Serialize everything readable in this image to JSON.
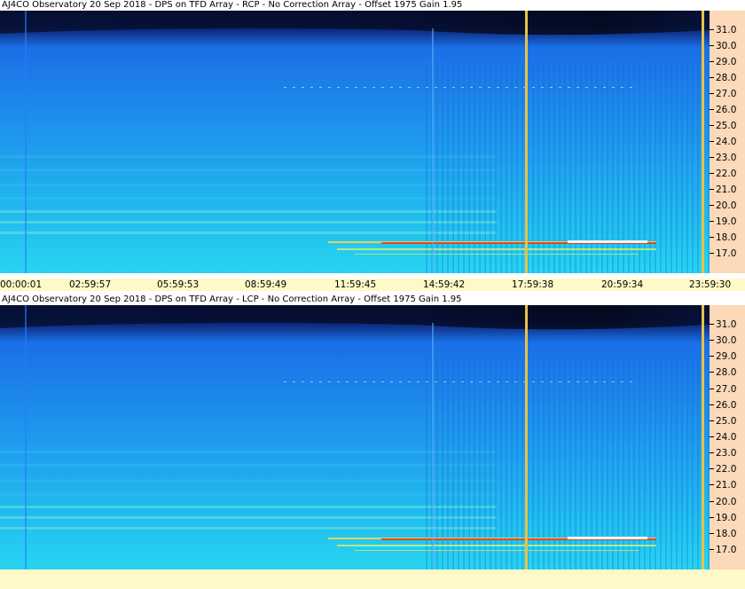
{
  "colors": {
    "cold": "#050d2e",
    "mid": "#1a6fe6",
    "warm": "#22c3ef",
    "hot": "#7ff0d8",
    "marker": "#e6c34a",
    "axis_bg": "#fcd9b8",
    "time_bg": "#fff8c8"
  },
  "panels": [
    {
      "title": "AJ4CO Observatory 20 Sep 2018 - DPS on TFD Array  - RCP  -  No Correction Array  -  Offset 1975  Gain 1.95",
      "y_ticks": [
        "31.0",
        "30.0",
        "29.0",
        "28.0",
        "27.0",
        "26.0",
        "25.0",
        "24.0",
        "23.0",
        "22.0",
        "21.0",
        "20.0",
        "19.0",
        "18.0",
        "17.0"
      ]
    },
    {
      "title": "AJ4CO Observatory 20 Sep 2018 - DPS on TFD Array  - LCP  -  No Correction Array  -  Offset 1975  Gain 1.95",
      "y_ticks": [
        "31.0",
        "30.0",
        "29.0",
        "28.0",
        "27.0",
        "26.0",
        "25.0",
        "24.0",
        "23.0",
        "22.0",
        "21.0",
        "20.0",
        "19.0",
        "18.0",
        "17.0"
      ]
    }
  ],
  "x_ticks": [
    "00:00:01",
    "02:59:57",
    "05:59:53",
    "08:59:49",
    "11:59:45",
    "14:59:42",
    "17:59:38",
    "20:59:34",
    "23:59:30"
  ],
  "chart_data": [
    {
      "type": "heatmap",
      "title": "AJ4CO Observatory 20 Sep 2018 - DPS on TFD Array  - RCP  -  No Correction Array  -  Offset 1975  Gain 1.95",
      "ylabel": "",
      "y_ticks": [
        31.0,
        30.0,
        29.0,
        28.0,
        27.0,
        26.0,
        25.0,
        24.0,
        23.0,
        22.0,
        21.0,
        20.0,
        19.0,
        18.0,
        17.0
      ],
      "ylim": [
        16.5,
        32.0
      ],
      "x_ticks": [
        "00:00:01",
        "02:59:57",
        "05:59:53",
        "08:59:49",
        "11:59:45",
        "14:59:42",
        "17:59:38",
        "20:59:34",
        "23:59:30"
      ],
      "markers": [
        "17:59:38",
        "23:59:30"
      ]
    },
    {
      "type": "heatmap",
      "title": "AJ4CO Observatory 20 Sep 2018 - DPS on TFD Array  - LCP  -  No Correction Array  -  Offset 1975  Gain 1.95",
      "ylabel": "",
      "y_ticks": [
        31.0,
        30.0,
        29.0,
        28.0,
        27.0,
        26.0,
        25.0,
        24.0,
        23.0,
        22.0,
        21.0,
        20.0,
        19.0,
        18.0,
        17.0
      ],
      "ylim": [
        16.5,
        32.0
      ],
      "x_ticks": [
        "00:00:01",
        "02:59:57",
        "05:59:53",
        "08:59:49",
        "11:59:45",
        "14:59:42",
        "17:59:38",
        "20:59:34",
        "23:59:30"
      ],
      "markers": [
        "17:59:38",
        "23:59:30"
      ]
    }
  ]
}
